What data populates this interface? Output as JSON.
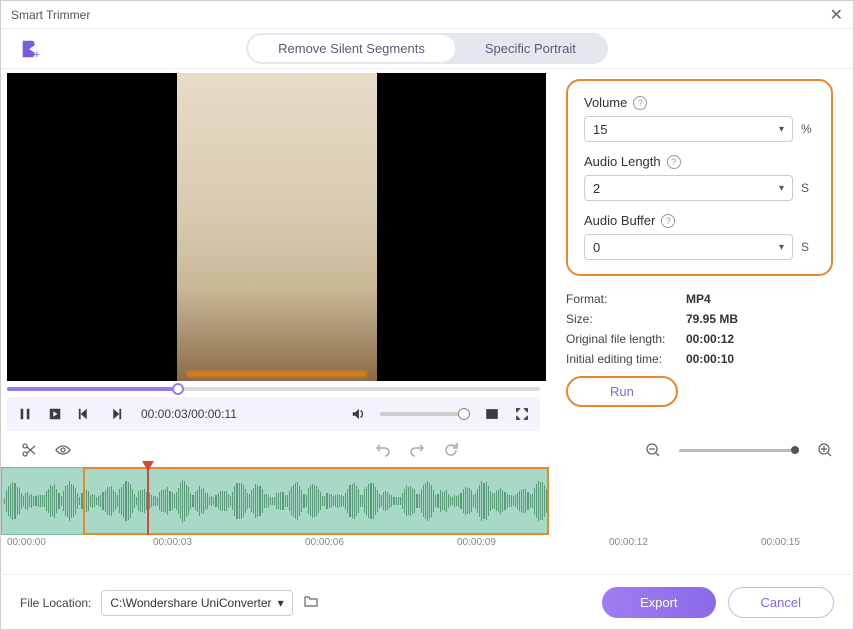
{
  "window": {
    "title": "Smart Trimmer"
  },
  "tabs": {
    "remove_silent": "Remove Silent Segments",
    "specific_portrait": "Specific Portrait"
  },
  "settings": {
    "volume_label": "Volume",
    "volume_value": "15",
    "volume_unit": "%",
    "audiolen_label": "Audio Length",
    "audiolen_value": "2",
    "audiolen_unit": "S",
    "audiobuf_label": "Audio Buffer",
    "audiobuf_value": "0",
    "audiobuf_unit": "S"
  },
  "info": {
    "format_label": "Format:",
    "format_value": "MP4",
    "size_label": "Size:",
    "size_value": "79.95 MB",
    "orig_label": "Original file length:",
    "orig_value": "00:00:12",
    "initial_label": "Initial editing time:",
    "initial_value": "00:00:10"
  },
  "run_label": "Run",
  "player": {
    "current": "00:00:03",
    "total": "00:00:11"
  },
  "ruler": [
    "00:00:00",
    "00:00:03",
    "00:00:06",
    "00:00:09",
    "00:00:12",
    "00:00:15"
  ],
  "footer": {
    "location_label": "File Location:",
    "location_value": "C:\\Wondershare UniConverter",
    "export": "Export",
    "cancel": "Cancel"
  }
}
